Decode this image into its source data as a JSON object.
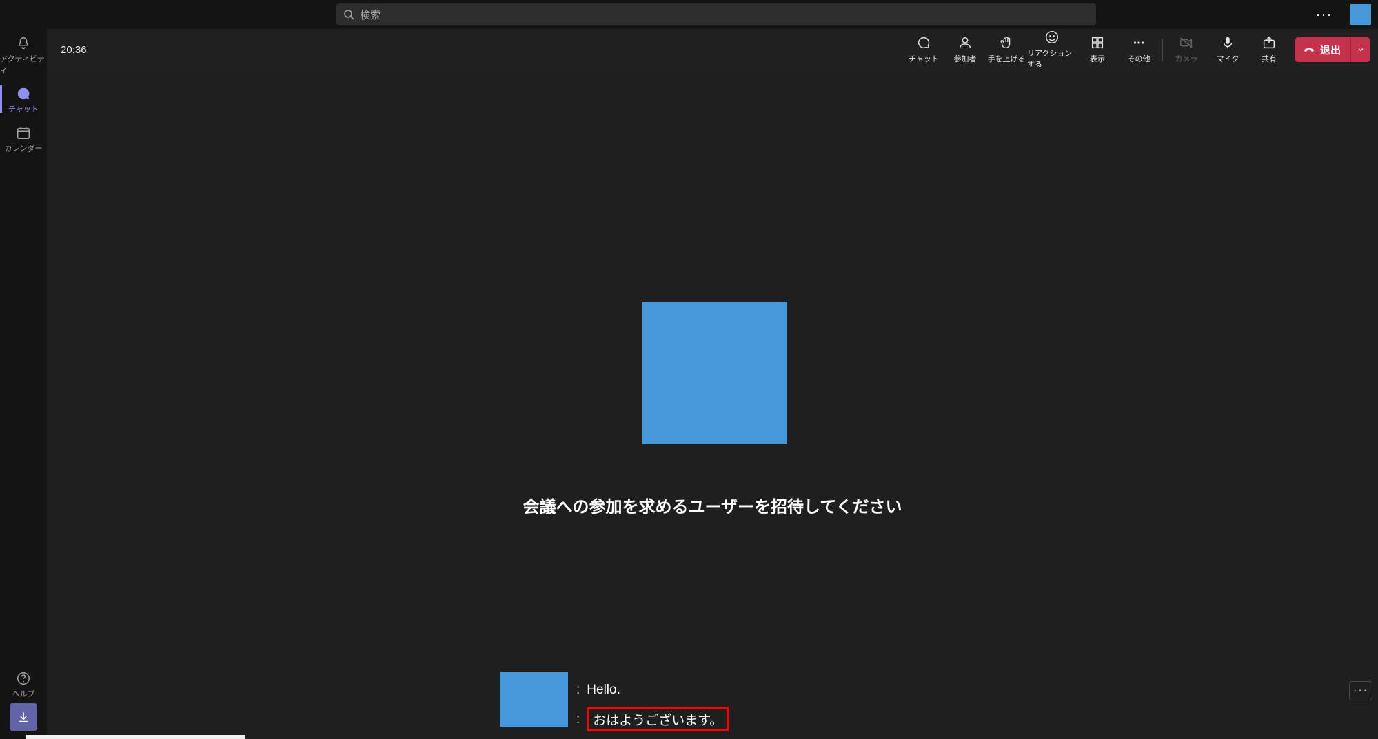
{
  "titlebar": {
    "search_placeholder": "検索"
  },
  "rail": {
    "activity": "アクティビティ",
    "chat": "チャット",
    "calendar": "カレンダー",
    "help": "ヘルプ"
  },
  "meetbar": {
    "clock": "20:36",
    "chat": "チャット",
    "people": "参加者",
    "raise": "手を上げる",
    "react": "リアクションする",
    "view": "表示",
    "more": "その他",
    "camera": "カメラ",
    "mic": "マイク",
    "share": "共有",
    "leave": "退出"
  },
  "stage": {
    "invite_msg": "会議への参加を求めるユーザーを招待してください"
  },
  "captions": {
    "line1": "Hello.",
    "line2": "おはようございます。"
  }
}
